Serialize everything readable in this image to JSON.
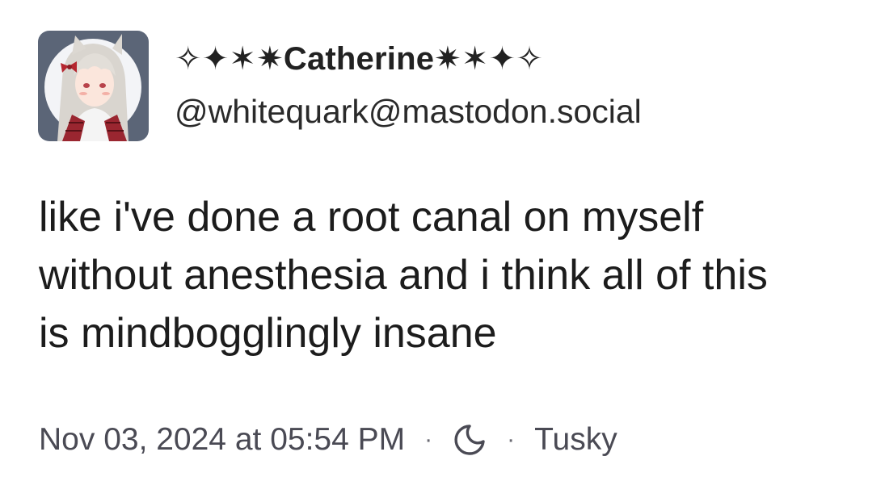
{
  "author": {
    "display_name": "✧✦✶✷Catherine✷✶✦✧",
    "handle": "@whitequark@mastodon.social",
    "avatar_icon": "anime-avatar"
  },
  "post": {
    "text": "like i've done a root canal on myself\nwithout anesthesia and i think all of this\nis mindbogglingly insane"
  },
  "meta": {
    "timestamp": "Nov 03, 2024 at 05:54 PM",
    "separator": "·",
    "visibility_icon": "moon-icon",
    "client": "Tusky"
  },
  "colors": {
    "text": "#1c1c1c",
    "meta_text": "#4a4a54"
  }
}
